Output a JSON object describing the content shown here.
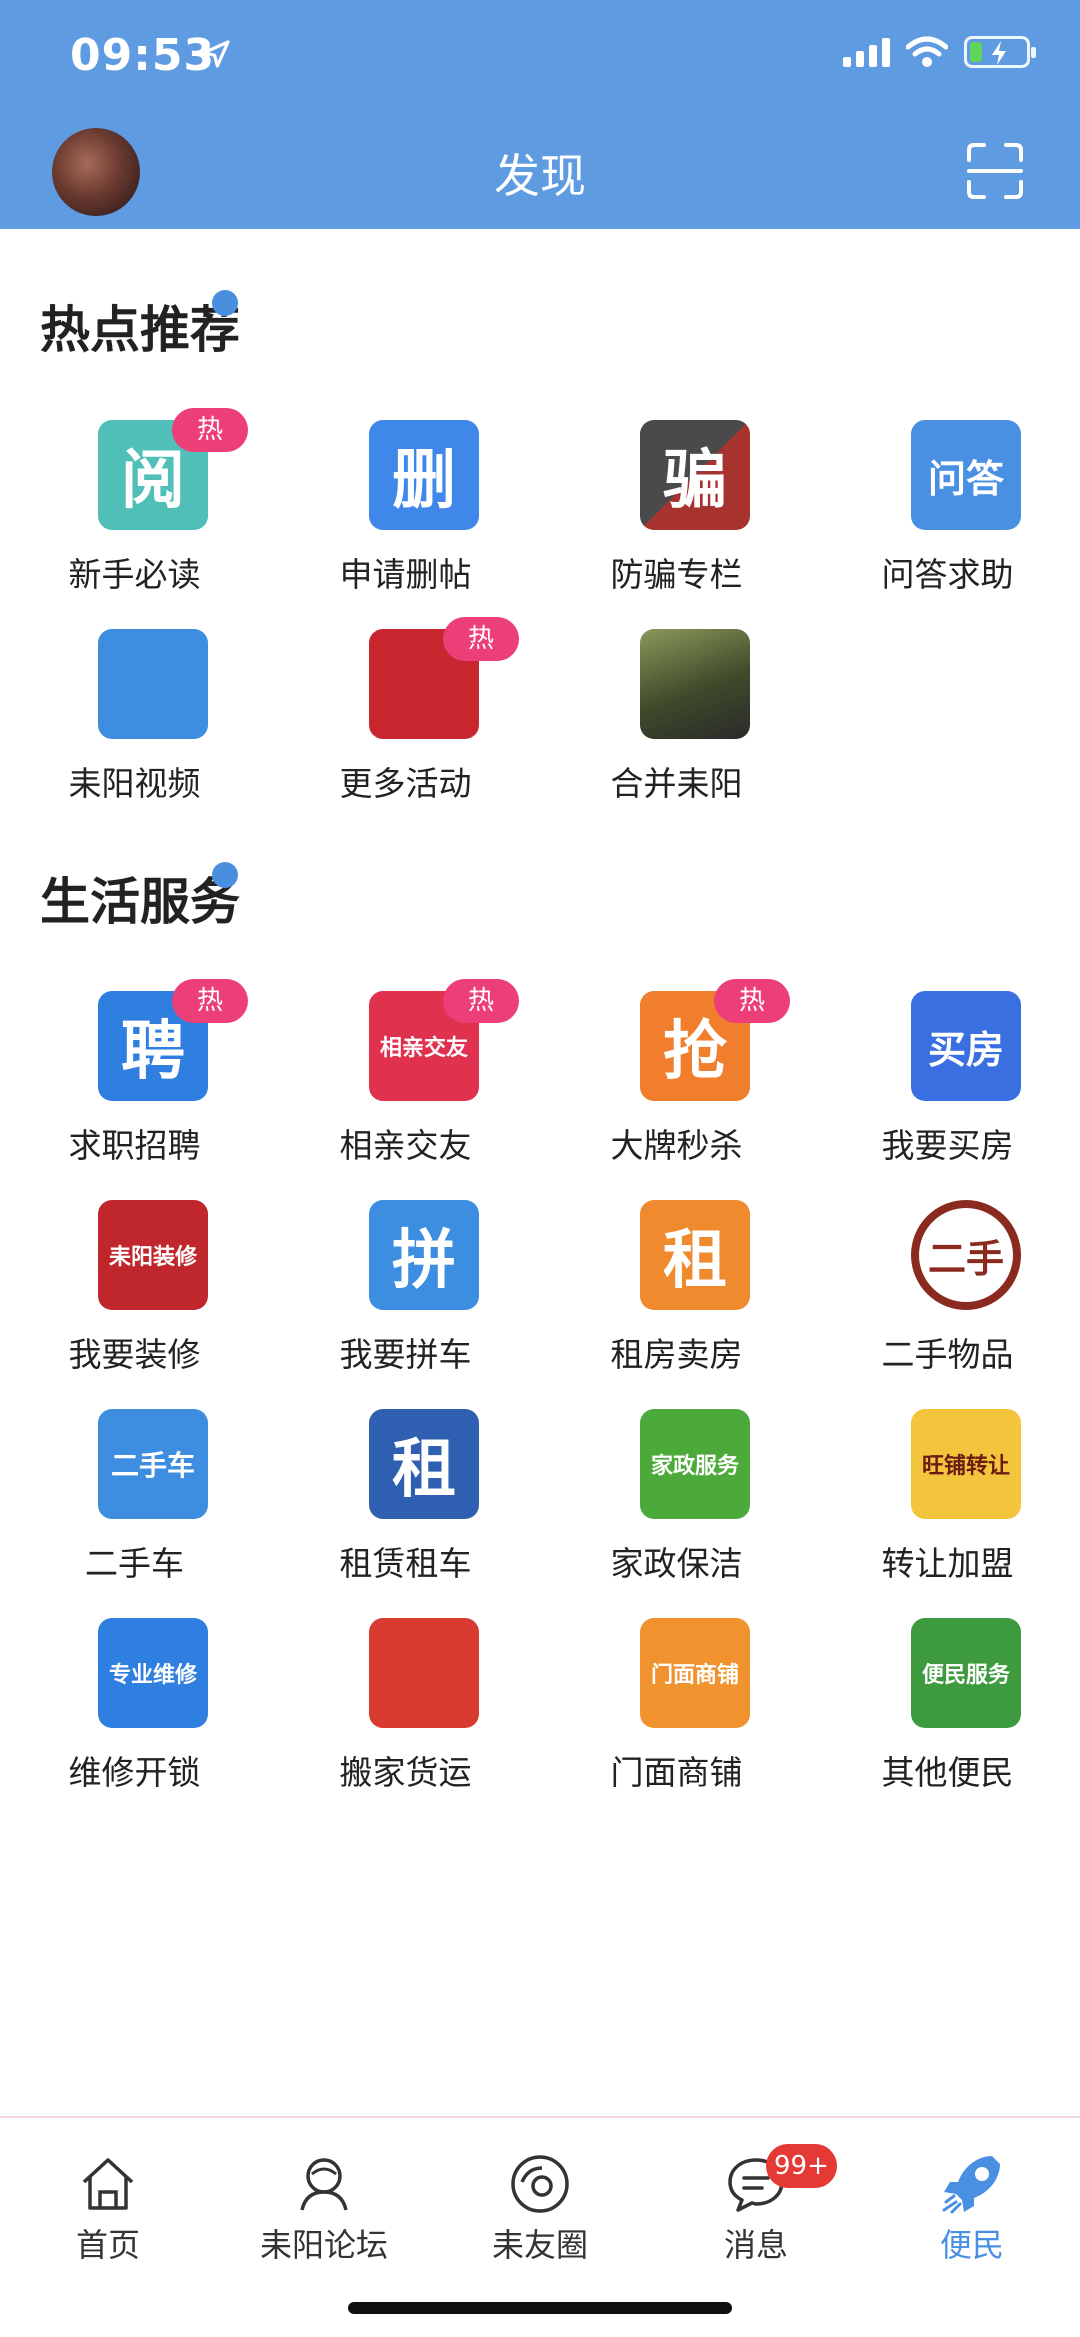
{
  "status": {
    "time": "09:53"
  },
  "header": {
    "title": "发现"
  },
  "sections": [
    {
      "title": "热点推荐",
      "items": [
        {
          "label": "新手必读",
          "icon": "read-book-icon",
          "icon_text": "阅",
          "bg": "#4fbfb8",
          "hot": "热"
        },
        {
          "label": "申请删帖",
          "icon": "delete-post-icon",
          "icon_text": "删",
          "bg": "#3f87e8"
        },
        {
          "label": "防骗专栏",
          "icon": "anti-fraud-icon",
          "icon_text": "骗",
          "bg": "#3b3b3b"
        },
        {
          "label": "问答求助",
          "icon": "qa-icon",
          "icon_text": "问答",
          "bg": "#4a90e2"
        },
        {
          "label": "耒阳视频",
          "icon": "video-play-icon",
          "icon_text": "",
          "bg": "#3d8ee0"
        },
        {
          "label": "更多活动",
          "icon": "gift-icon",
          "icon_text": "",
          "bg": "#c8262e",
          "hot": "热"
        },
        {
          "label": "合并耒阳",
          "icon": "character-avatar-icon",
          "icon_text": "",
          "bg": "#5a6b3d"
        }
      ]
    },
    {
      "title": "生活服务",
      "items": [
        {
          "label": "求职招聘",
          "icon": "recruit-icon",
          "icon_text": "聘",
          "bg": "#2f7fe0",
          "hot": "热"
        },
        {
          "label": "相亲交友",
          "icon": "dating-icon",
          "icon_text": "相亲交友",
          "bg": "#e0314f",
          "hot": "热"
        },
        {
          "label": "大牌秒杀",
          "icon": "flash-sale-icon",
          "icon_text": "抢",
          "bg": "#f07e2c",
          "hot": "热"
        },
        {
          "label": "我要买房",
          "icon": "buy-house-icon",
          "icon_text": "买房",
          "bg": "#3a6fe2"
        },
        {
          "label": "我要装修",
          "icon": "decoration-icon",
          "icon_text": "耒阳装修",
          "bg": "#c0272d"
        },
        {
          "label": "我要拼车",
          "icon": "carpool-icon",
          "icon_text": "拼",
          "bg": "#3d8ee0"
        },
        {
          "label": "租房卖房",
          "icon": "rent-house-icon",
          "icon_text": "租",
          "bg": "#ef8a2e"
        },
        {
          "label": "二手物品",
          "icon": "second-hand-icon",
          "icon_text": "二手",
          "bg": "#8b2a1f"
        },
        {
          "label": "二手车",
          "icon": "used-car-icon",
          "icon_text": "二手车",
          "bg": "#3d8ee0"
        },
        {
          "label": "租赁租车",
          "icon": "rental-truck-icon",
          "icon_text": "租",
          "bg": "#2f5fb0"
        },
        {
          "label": "家政保洁",
          "icon": "housekeeping-icon",
          "icon_text": "家政服务",
          "bg": "#4caa3a"
        },
        {
          "label": "转让加盟",
          "icon": "shop-transfer-icon",
          "icon_text": "旺铺转让",
          "bg": "#f2c53d"
        },
        {
          "label": "维修开锁",
          "icon": "repair-icon",
          "icon_text": "专业维修",
          "bg": "#2f7fe0"
        },
        {
          "label": "搬家货运",
          "icon": "moving-truck-icon",
          "icon_text": "",
          "bg": "#d93b30"
        },
        {
          "label": "门面商铺",
          "icon": "storefront-icon",
          "icon_text": "门面商铺",
          "bg": "#f0922e"
        },
        {
          "label": "其他便民",
          "icon": "convenience-icon",
          "icon_text": "便民服务",
          "bg": "#3e9a3e"
        }
      ]
    }
  ],
  "tabs": [
    {
      "label": "首页",
      "icon": "home-icon"
    },
    {
      "label": "耒阳论坛",
      "icon": "forum-icon"
    },
    {
      "label": "耒友圈",
      "icon": "circle-icon"
    },
    {
      "label": "消息",
      "icon": "message-icon",
      "badge": "99+"
    },
    {
      "label": "便民",
      "icon": "rocket-icon",
      "active": true
    }
  ]
}
